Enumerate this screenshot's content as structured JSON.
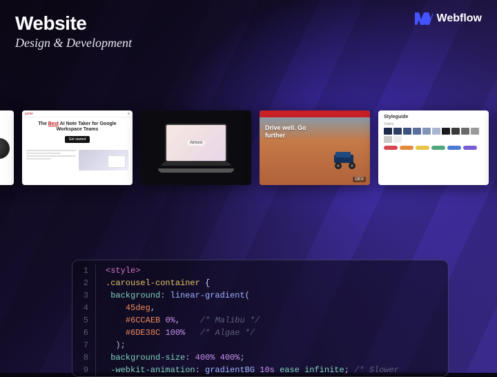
{
  "header": {
    "title": "Website",
    "subtitle": "Design & Development"
  },
  "brand": {
    "name": "Webflow",
    "accent": "#4353ff"
  },
  "carousel": {
    "slides": [
      {
        "kind": "peek-left"
      },
      {
        "kind": "notetaker",
        "headline_prefix": "The ",
        "headline_best": "Best",
        "headline_rest": " AI Note Taker for Google Workspace Teams",
        "cta": "Get started"
      },
      {
        "kind": "laptop",
        "badge": "Almost"
      },
      {
        "kind": "drive",
        "tagline_l1": "Drive well. Go",
        "tagline_l2": "further",
        "corner": "OEX"
      },
      {
        "kind": "styleguide",
        "title": "Styleguide",
        "label_colors": "Colors",
        "swatches": [
          "#1d2b4a",
          "#2d3e64",
          "#3e5280",
          "#5a6f9c",
          "#8095b8",
          "#a8b7d0",
          "#1a1a1a",
          "#3a3a3a",
          "#6a6a6a",
          "#9a9a9a",
          "#cacaca",
          "#eeeeee"
        ],
        "pills": [
          "#d64550",
          "#e58a3c",
          "#e8c547",
          "#4fa77a",
          "#4a7bd6",
          "#7a5cd6"
        ]
      },
      {
        "kind": "peek-right"
      }
    ]
  },
  "code": {
    "line_numbers": [
      "1",
      "2",
      "3",
      "4",
      "5",
      "6",
      "7",
      "8",
      "9"
    ],
    "l1": {
      "open": "<style>"
    },
    "l2": {
      "selector": ".carousel-container",
      "brace": " {"
    },
    "l3": {
      "prop": " background",
      "func": "linear-gradient"
    },
    "l4": {
      "deg": "45deg"
    },
    "l5": {
      "hex": "#6CCAEB",
      "pct": "0%",
      "comment": "/* Malibu */"
    },
    "l6": {
      "hex": "#6DE38C",
      "pct": "100%",
      "comment": "/* Algae */"
    },
    "l7": {
      "close_paren": ");"
    },
    "l8": {
      "prop": " background-size",
      "val": "400% 400%"
    },
    "l9": {
      "prop": " -webkit-animation",
      "name": "gradientBG",
      "dur": "10s",
      "easing": "ease",
      "iter": "infinite",
      "comment": "/* Slower"
    }
  }
}
